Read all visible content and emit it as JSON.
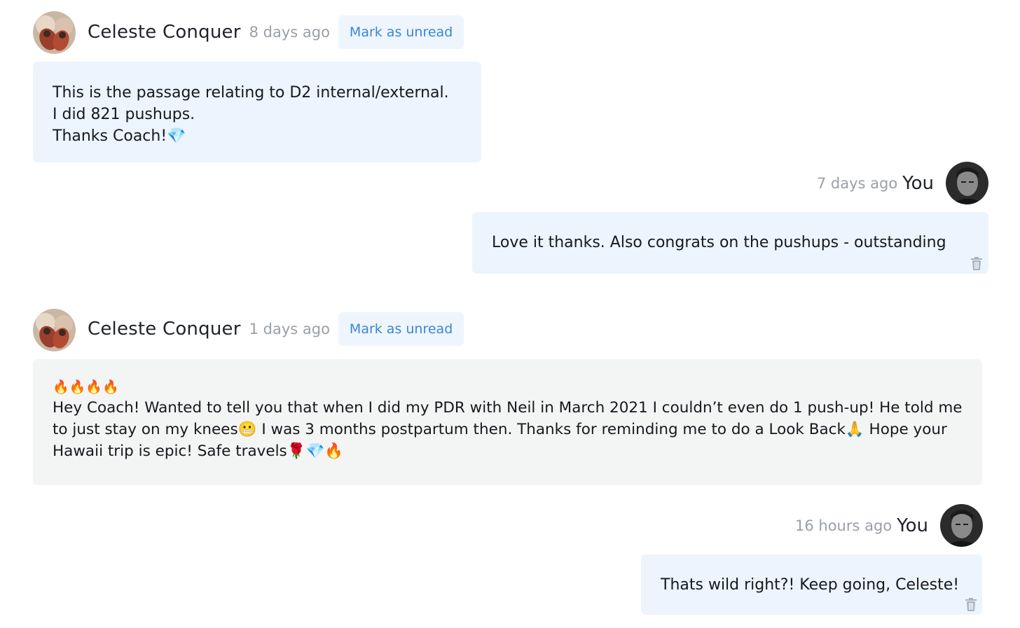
{
  "messages": [
    {
      "sender": "Celeste Conquer",
      "time": "8 days ago",
      "action_label": "Mark as unread",
      "lines": [
        "This is the passage relating to D2 internal/external.",
        "I did 821 pushups.",
        "Thanks Coach!"
      ],
      "trailing_emoji": "💎"
    },
    {
      "sender": "You",
      "time": "7 days ago",
      "text": "Love it thanks.  Also congrats on the pushups - outstanding"
    },
    {
      "sender": "Celeste Conquer",
      "time": "1 days ago",
      "action_label": "Mark as unread",
      "emoji_line": "🔥🔥🔥🔥",
      "text_part1": "Hey Coach! Wanted to tell you that when I did my PDR with Neil in March 2021 I couldn’t even do 1 push-up! He told me to just stay on my knees",
      "emoji_grimace": "😬",
      "text_part2": " I was 3 months postpartum then. Thanks for reminding me to do a Look Back",
      "emoji_pray": "🙏",
      "text_part3": " Hope your Hawaii trip is epic! Safe travels",
      "trailing_emojis": "🌹💎🔥"
    },
    {
      "sender": "You",
      "time": "16 hours ago",
      "text": "Thats wild right?!  Keep going, Celeste!"
    }
  ],
  "colors": {
    "accent": "#3a87d4",
    "incoming_bubble": "#ecf4fd",
    "grey_bubble": "#f3f4f4",
    "timestamp": "#9aa0a6"
  }
}
